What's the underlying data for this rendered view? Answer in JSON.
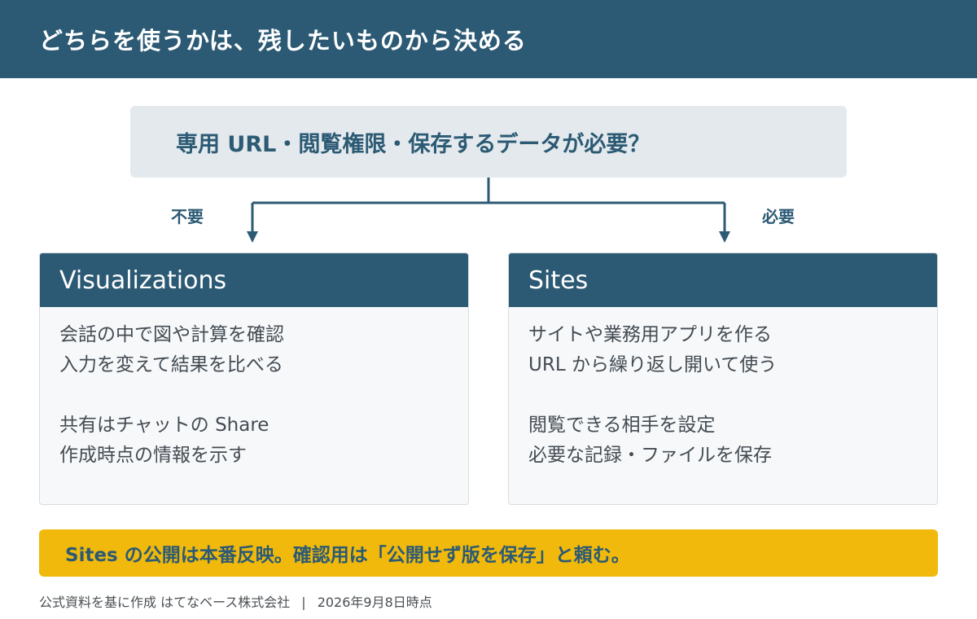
{
  "header": {
    "title": "どちらを使うかは、残したいものから決める"
  },
  "question": {
    "text": "専用 URL・閲覧権限・保存するデータが必要？"
  },
  "branches": {
    "left_label": "不要",
    "right_label": "必要"
  },
  "cards": [
    {
      "title": "Visualizations",
      "lines_group1": [
        "会話の中で図や計算を確認",
        "入力を変えて結果を比べる"
      ],
      "lines_group2": [
        "共有はチャットの Share",
        "作成時点の情報を示す"
      ]
    },
    {
      "title": "Sites",
      "lines_group1": [
        "サイトや業務用アプリを作る",
        "URL から繰り返し開いて使う"
      ],
      "lines_group2": [
        "閲覧できる相手を設定",
        "必要な記録・ファイルを保存"
      ]
    }
  ],
  "note": {
    "text": "Sites の公開は本番反映。確認用は「公開せず版を保存」と頼む。"
  },
  "footer": {
    "source": "公式資料を基に作成 はてなベース株式会社",
    "separator": "|",
    "date": "2026年9月8日時点"
  },
  "colors": {
    "primary": "#2c5a74",
    "accent": "#f0b90b",
    "question_bg": "#e3e9ec"
  }
}
